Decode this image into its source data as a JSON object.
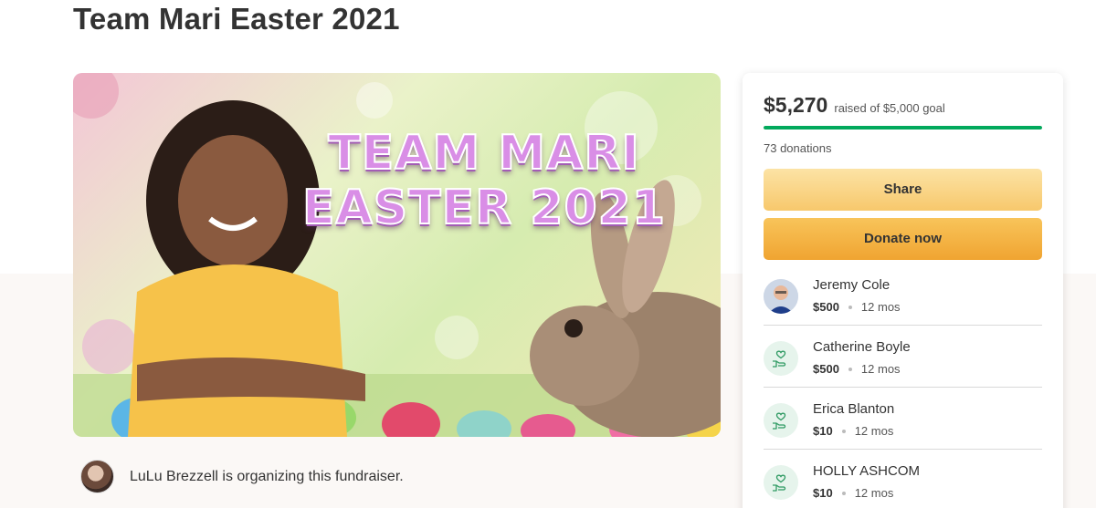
{
  "page": {
    "title": "Team Mari Easter 2021"
  },
  "hero": {
    "line1": "TEAM MARI",
    "line2": "EASTER 2021"
  },
  "organizer": {
    "text": "LuLu Brezzell is organizing this fundraiser."
  },
  "fundraiser": {
    "raised": "$5,270",
    "goal_label": "raised of $5,000 goal",
    "progress_fraction": 1.0,
    "donations_count": "73 donations",
    "share_label": "Share",
    "donate_label": "Donate now"
  },
  "donors": [
    {
      "name": "Jeremy Cole",
      "amount": "$500",
      "time": "12 mos",
      "avatar": "photo"
    },
    {
      "name": "Catherine Boyle",
      "amount": "$500",
      "time": "12 mos",
      "avatar": "heart-hand-icon"
    },
    {
      "name": "Erica Blanton",
      "amount": "$10",
      "time": "12 mos",
      "avatar": "heart-hand-icon"
    },
    {
      "name": "HOLLY ASHCOM",
      "amount": "$10",
      "time": "12 mos",
      "avatar": "heart-hand-icon"
    }
  ],
  "colors": {
    "progress": "#02a95c",
    "donate_button": "#f0a431",
    "share_button": "#f7c86c",
    "hero_title": "#d98ee6"
  }
}
